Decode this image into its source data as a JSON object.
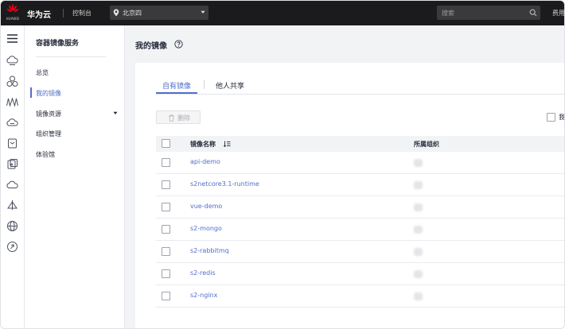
{
  "topbar": {
    "logo_text": "HUAWEI",
    "brand": "华为云",
    "console": "控制台",
    "region": "北京四",
    "search_placeholder": "搜索",
    "fee": "费用"
  },
  "rail": {
    "items": [
      "menu-icon",
      "cloud-server-icon",
      "cluster-icon",
      "network-icon",
      "storage-icon",
      "database-icon",
      "container-icon",
      "cloud-icon",
      "vpn-icon",
      "globe-icon",
      "settings-circle-icon"
    ]
  },
  "sidebar": {
    "title": "容器镜像服务",
    "items": [
      {
        "label": "总览"
      },
      {
        "label": "我的镜像"
      },
      {
        "label": "镜像资源"
      },
      {
        "label": "组织管理"
      },
      {
        "label": "体验馆"
      }
    ]
  },
  "main": {
    "page_title": "我的镜像",
    "tabs": [
      {
        "label": "自有镜像"
      },
      {
        "label": "他人共享"
      }
    ],
    "delete_label": "删除",
    "right_check_label": "我",
    "table": {
      "columns": [
        "镜像名称",
        "所属组织"
      ],
      "rows": [
        {
          "name": "api-demo"
        },
        {
          "name": "s2netcore3.1-runtime"
        },
        {
          "name": "vue-demo"
        },
        {
          "name": "s2-mongo"
        },
        {
          "name": "s2-rabbitmq"
        },
        {
          "name": "s2-redis"
        },
        {
          "name": "s2-nginx"
        }
      ]
    }
  },
  "colors": {
    "topbar_bg": "#1b1b1d",
    "accent": "#526ecc",
    "brand_red": "#e60012",
    "page_bg": "#f2f3f5"
  }
}
